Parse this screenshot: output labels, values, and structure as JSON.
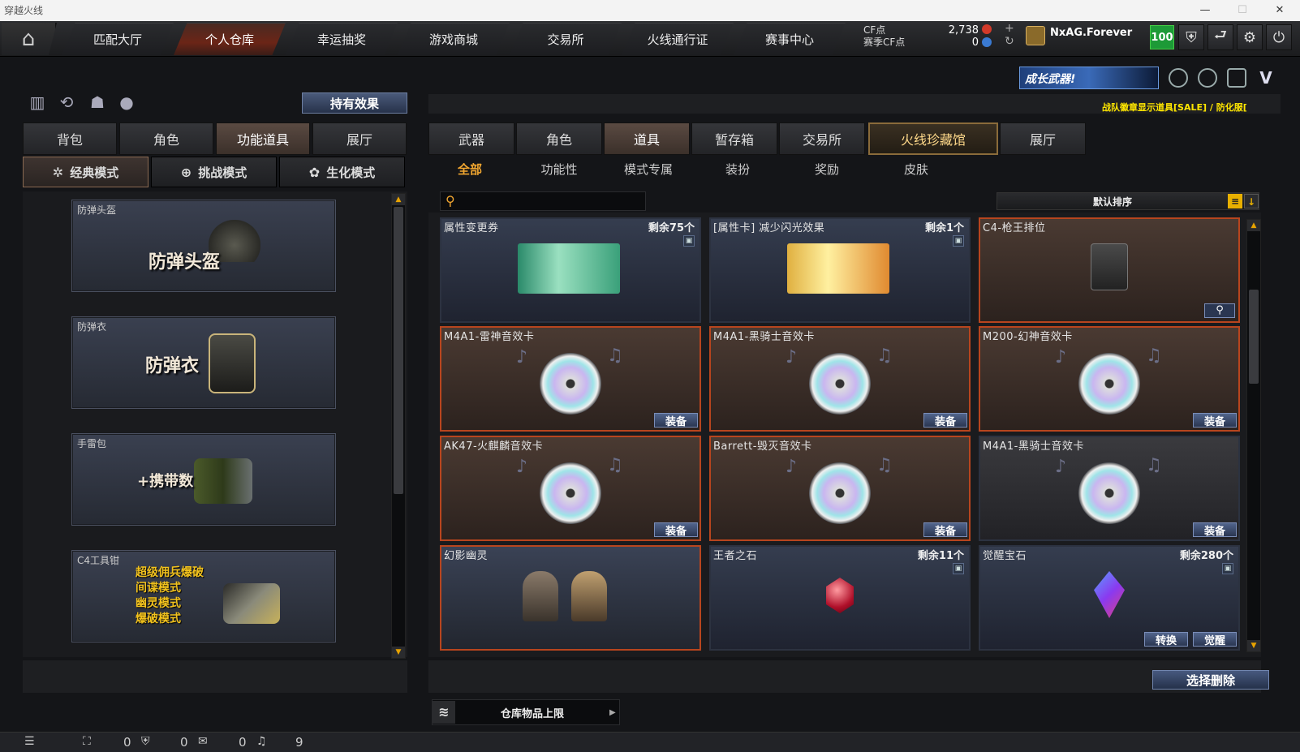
{
  "window": {
    "title": "穿越火线",
    "minimize": "—",
    "maximize": "☐",
    "close": "✕"
  },
  "nav": {
    "home_icon": "home-icon",
    "tabs": [
      "匹配大厅",
      "个人仓库",
      "幸运抽奖",
      "游戏商城",
      "交易所",
      "火线通行证",
      "赛事中心"
    ],
    "active_tab": "个人仓库"
  },
  "currency": {
    "cf_label": "CF点",
    "season_label": "赛季CF点",
    "cf_value": "2,738",
    "season_value": "0",
    "add": "+",
    "refresh": "↻"
  },
  "user": {
    "name": "NxAG.Forever",
    "level": "100"
  },
  "toolbar_icons": [
    "shield-icon",
    "return-icon",
    "gear-icon",
    "power-icon"
  ],
  "banner": {
    "text": "成长武器!",
    "notice": "战队徽章显示道具[SALE] / 防化服["
  },
  "left": {
    "hold_effect": "持有效果",
    "tabs": [
      "背包",
      "角色",
      "功能道具",
      "展厅"
    ],
    "active_tab": "功能道具",
    "modes": [
      {
        "label": "经典模式",
        "icon": "✲"
      },
      {
        "label": "挑战模式",
        "icon": "⊕"
      },
      {
        "label": "生化模式",
        "icon": "✿"
      }
    ],
    "active_mode": "经典模式",
    "cards": [
      {
        "label": "防弹头盔",
        "big": "防弹头盔"
      },
      {
        "label": "防弹衣",
        "big": "防弹衣"
      },
      {
        "label": "手雷包",
        "big": "+携带数"
      },
      {
        "label": "C4工具钳",
        "modes": [
          "超级佣兵爆破",
          "间谍模式",
          "幽灵模式",
          "爆破模式"
        ]
      }
    ]
  },
  "right": {
    "tabs": [
      "武器",
      "角色",
      "道具",
      "暂存箱",
      "交易所",
      "火线珍藏馆",
      "展厅"
    ],
    "active_tab": "道具",
    "subtabs": [
      "全部",
      "功能性",
      "模式专属",
      "装扮",
      "奖励",
      "皮肤"
    ],
    "active_subtab": "全部",
    "search_placeholder": "",
    "sort_label": "默认排序",
    "items": [
      {
        "name": "属性变更券",
        "remain": "剩余75个",
        "trash": true,
        "kind": "ticket-green"
      },
      {
        "name": "[属性卡] 减少闪光效果",
        "remain": "剩余1个",
        "trash": true,
        "kind": "ticket-gold"
      },
      {
        "name": "C4-枪王排位",
        "remain": "",
        "hot": true,
        "kind": "c4",
        "search_btn": true
      },
      {
        "name": "M4A1-雷神音效卡",
        "hot": true,
        "kind": "disc",
        "button": "装备"
      },
      {
        "name": "M4A1-黑骑士音效卡",
        "hot": true,
        "kind": "disc",
        "button": "装备"
      },
      {
        "name": "M200-幻神音效卡",
        "hot": true,
        "kind": "disc",
        "button": "装备"
      },
      {
        "name": "AK47-火麒麟音效卡",
        "hot": true,
        "kind": "disc",
        "button": "装备"
      },
      {
        "name": "Barrett-毁灭音效卡",
        "hot": true,
        "kind": "disc",
        "button": "装备"
      },
      {
        "name": "M4A1-黑骑士音效卡",
        "hot": false,
        "kind": "disc",
        "button": "装备"
      },
      {
        "name": "幻影幽灵",
        "hot": true,
        "kind": "ghost"
      },
      {
        "name": "王者之石",
        "remain": "剩余11个",
        "trash": true,
        "kind": "gem-red"
      },
      {
        "name": "觉醒宝石",
        "remain": "剩余280个",
        "trash": true,
        "kind": "gem-purple",
        "buttons": [
          "转换",
          "觉醒"
        ]
      }
    ],
    "delete_btn": "选择删除",
    "capacity": "仓库物品上限"
  },
  "status": {
    "binoculars": "0",
    "shield": "0",
    "chat": "0",
    "volume": "9"
  },
  "colors": {
    "accent_orange": "#f1a630",
    "hot_border": "#b8451e",
    "button_blue": "#2a3651",
    "level_green": "#1d9a37"
  }
}
